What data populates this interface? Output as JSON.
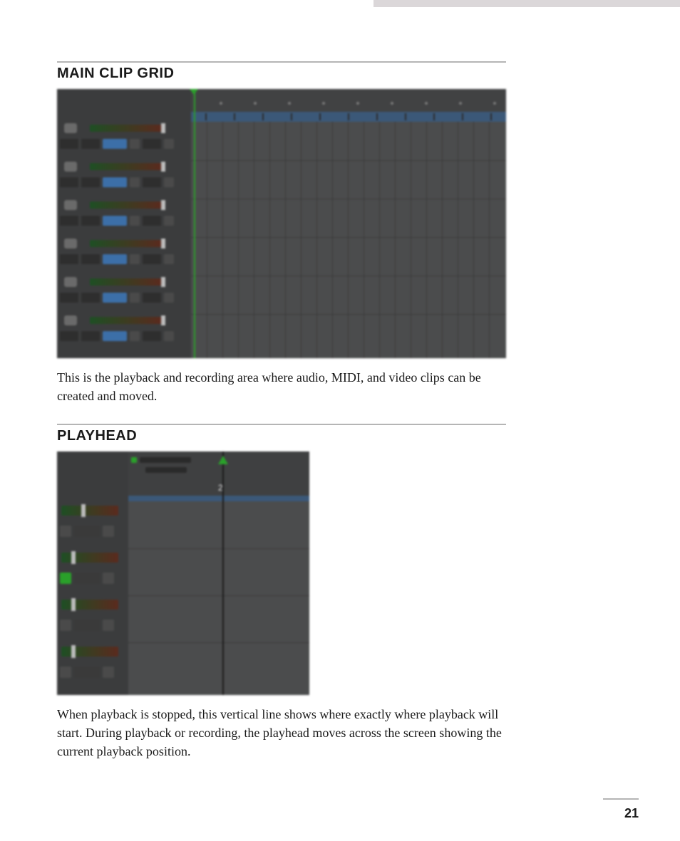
{
  "page_number": "21",
  "sections": {
    "main_clip_grid": {
      "title": "MAIN CLIP GRID",
      "caption": "This is the playback and recording area where audio, MIDI, and video clips can be created and moved."
    },
    "playhead": {
      "title": "PLAYHEAD",
      "caption": "When playback is stopped, this vertical line shows where exactly where playback will start. During playback or recording, the playhead moves across the screen showing the current playback position.",
      "bar_number": "2"
    }
  }
}
